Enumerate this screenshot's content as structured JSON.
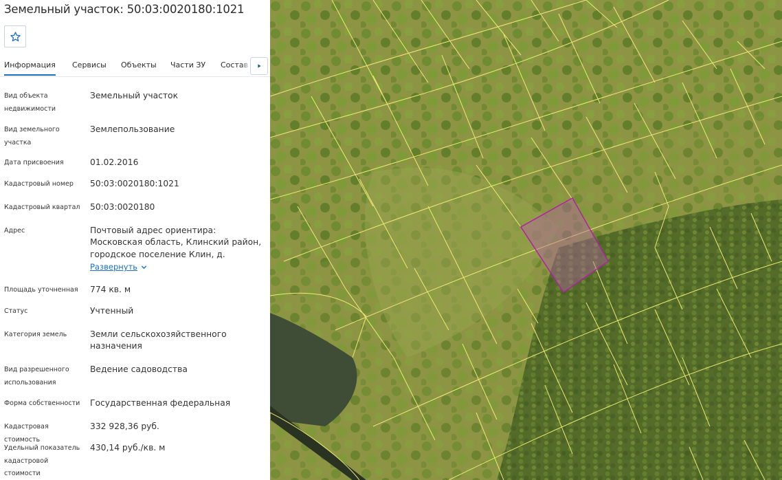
{
  "header": {
    "title": "Земельный участок: 50:03:0020180:1021"
  },
  "tabs": [
    {
      "label": "Информация",
      "active": true
    },
    {
      "label": "Сервисы",
      "active": false
    },
    {
      "label": "Объекты",
      "active": false
    },
    {
      "label": "Части ЗУ",
      "active": false
    },
    {
      "label": "Состав ЕЗП",
      "active": false
    }
  ],
  "fields": [
    {
      "label": "Вид объекта недвижимости",
      "value": "Земельный участок"
    },
    {
      "label": "Вид земельного участка",
      "value": "Землепользование"
    },
    {
      "label": "Дата присвоения",
      "value": "01.02.2016"
    },
    {
      "label": "Кадастровый номер",
      "value": "50:03:0020180:1021"
    },
    {
      "label": "Кадастровый квартал",
      "value": "50:03:0020180"
    },
    {
      "label": "Адрес",
      "value": "Почтовый адрес ориентира: Московская область, Клинский район, городское поселение Клин, д.",
      "expand_label": "Развернуть"
    },
    {
      "label": "Площадь уточненная",
      "value": "774 кв. м"
    },
    {
      "label": "Статус",
      "value": "Учтенный"
    },
    {
      "label": "Категория земель",
      "value": "Земли сельскохозяйственного назначения"
    },
    {
      "label": "Вид разрешенного использования",
      "value": "Ведение садоводства"
    },
    {
      "label": "Форма собственности",
      "value": "Государственная федеральная"
    },
    {
      "label": "Кадастровая стоимость",
      "value": "332 928,36 руб."
    },
    {
      "label": "Удельный показатель кадастровой стоимости",
      "value": "430,14 руб./кв. м"
    }
  ],
  "icons": {
    "favorite": "star-outline-icon",
    "tab_scroll": "caret-right-icon",
    "expand": "chevron-down-icon"
  },
  "colors": {
    "accent": "#1a6ec7",
    "parcel_boundary": "#f4ef78",
    "selected_parcel": "#b31fa6"
  }
}
